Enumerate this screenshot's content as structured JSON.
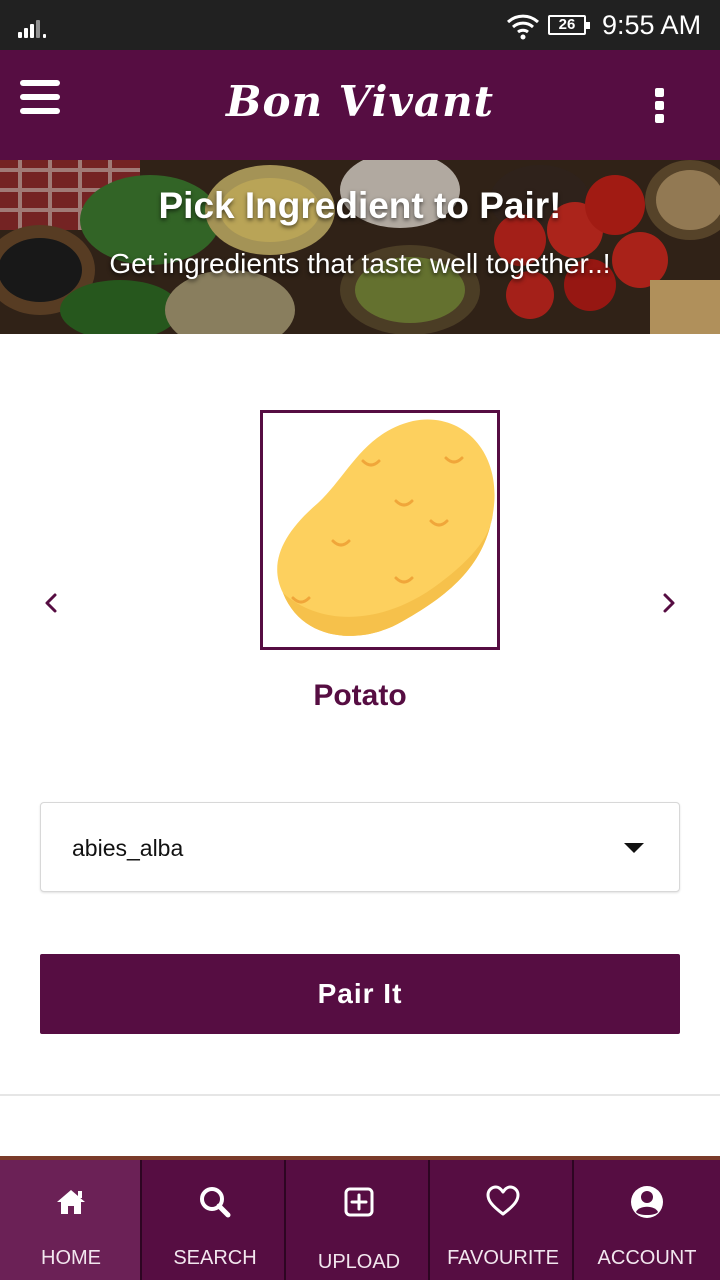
{
  "status_bar": {
    "battery": "26",
    "time": "9:55 AM"
  },
  "app_bar": {
    "title": "Bon Vivant"
  },
  "banner": {
    "title": "Pick Ingredient to Pair!",
    "subtitle": "Get ingredients that taste well together..!"
  },
  "carousel": {
    "ingredient_name": "Potato",
    "icon": "potato-image"
  },
  "dropdown": {
    "selected_value": "abies_alba"
  },
  "pair_button": {
    "label": "Pair It"
  },
  "bottom_nav": {
    "items": [
      {
        "label": "HOME",
        "icon": "home-icon",
        "active": true
      },
      {
        "label": "SEARCH",
        "icon": "search-icon",
        "active": false
      },
      {
        "label": "UPLOAD",
        "icon": "plus-square-icon",
        "active": false
      },
      {
        "label": "FAVOURITE",
        "icon": "heart-icon",
        "active": false
      },
      {
        "label": "ACCOUNT",
        "icon": "account-icon",
        "active": false
      }
    ]
  },
  "colors": {
    "primary": "#560d42",
    "active_tab": "#6b2156",
    "status_bar": "#212121",
    "potato": "#fdd05e"
  }
}
